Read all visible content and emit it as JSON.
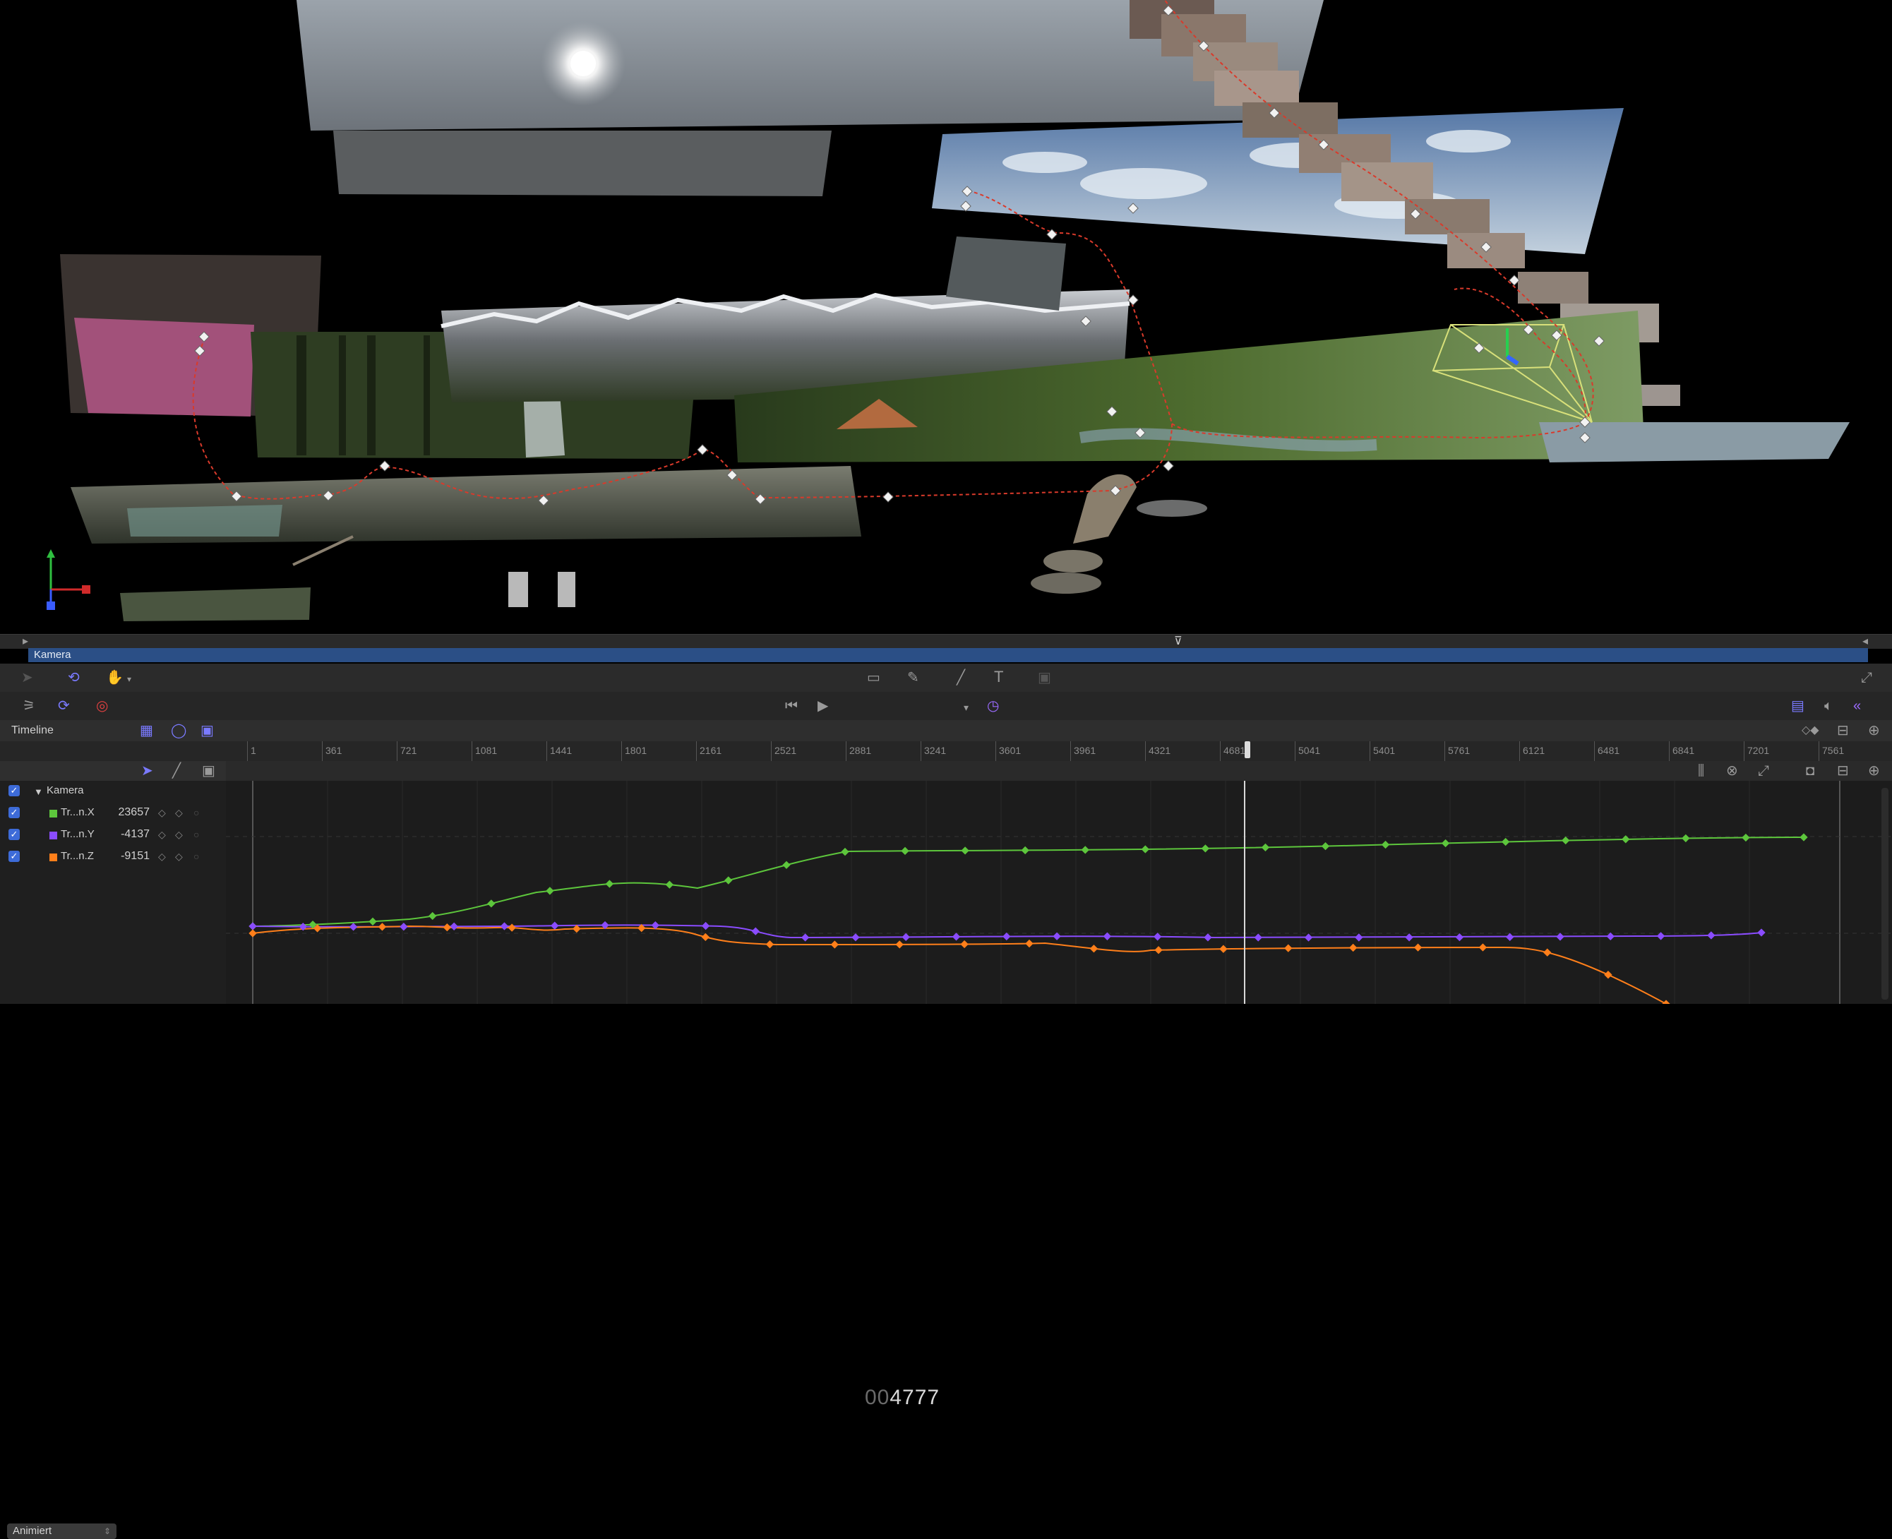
{
  "track": {
    "label": "Kamera"
  },
  "toolbar": {
    "text_tool": "T"
  },
  "transport": {
    "timecode_prefix": "00",
    "timecode_value": "4777"
  },
  "timeline": {
    "title": "Timeline",
    "ruler_ticks": [
      "1",
      "361",
      "721",
      "1081",
      "1441",
      "1801",
      "2161",
      "2521",
      "2881",
      "3241",
      "3601",
      "3961",
      "4321",
      "4681",
      "5041",
      "5401",
      "5761",
      "6121",
      "6481",
      "6841",
      "7201",
      "7561"
    ],
    "filter_label": "Animiert",
    "group_label": "Kamera",
    "params": [
      {
        "name": "Tr...n.X",
        "value": "23657",
        "color": "#5dc63c"
      },
      {
        "name": "Tr...n.Y",
        "value": "-4137",
        "color": "#8a4cff"
      },
      {
        "name": "Tr...n.Z",
        "value": "-9151",
        "color": "#ff7f1a"
      }
    ]
  },
  "colors": {
    "track_bar": "#2b4f86",
    "curve_x": "#5dc63c",
    "curve_y": "#8a4cff",
    "curve_z": "#ff7f1a",
    "motion_path": "#d93a2b",
    "accent": "#6c6cff"
  }
}
